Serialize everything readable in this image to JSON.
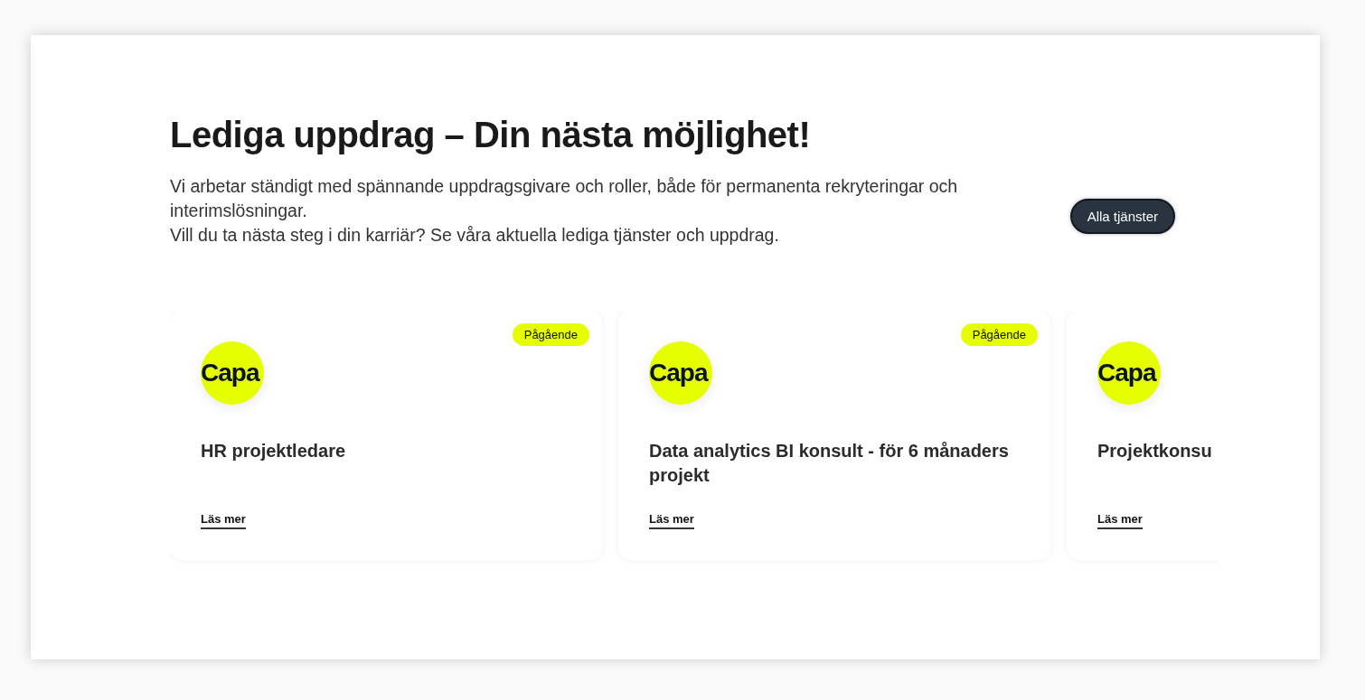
{
  "heading": "Lediga uppdrag – Din nästa möjlighet!",
  "intro": [
    "Vi arbetar ständigt med spännande uppdragsgivare och roller, både för permanenta rekryteringar och interimslösningar.",
    "Vill du ta nästa steg i din karriär? Se våra aktuella lediga tjänster och uppdrag."
  ],
  "all_button": "Alla tjänster",
  "cards": [
    {
      "status": "Pågående",
      "logo": "Capa",
      "title": "HR projektledare",
      "link": "Läs mer"
    },
    {
      "status": "Pågående",
      "logo": "Capa",
      "title": "Data analytics BI konsult - för 6 månaders projekt",
      "link": "Läs mer"
    },
    {
      "logo": "Capa",
      "title": "Projektkonsu",
      "link": "Läs mer"
    }
  ]
}
